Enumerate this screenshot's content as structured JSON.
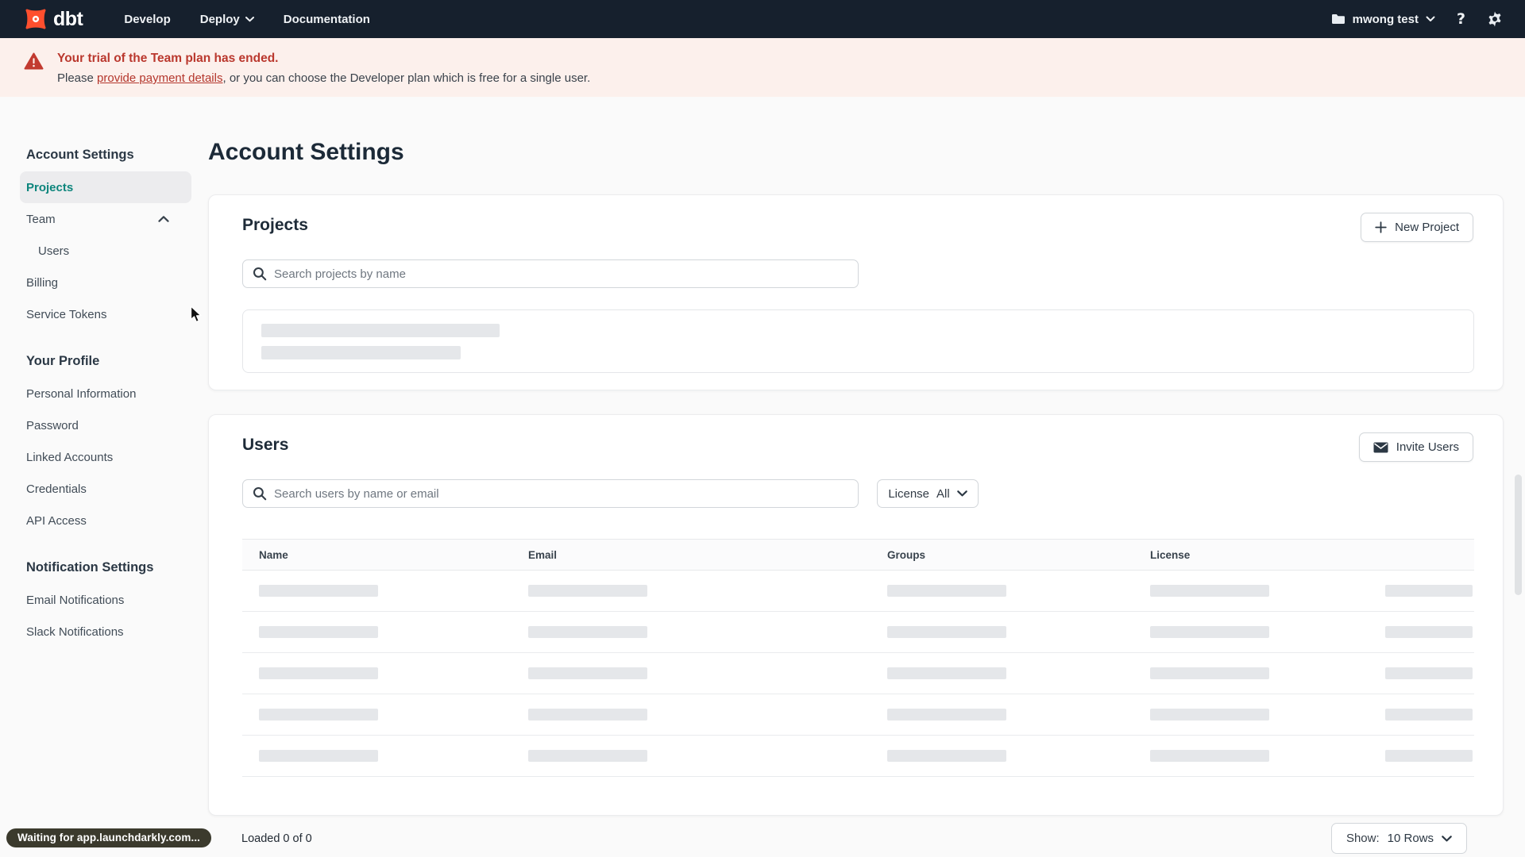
{
  "navbar": {
    "logo_text": "dbt",
    "menu": [
      {
        "label": "Develop"
      },
      {
        "label": "Deploy",
        "has_chevron": true
      },
      {
        "label": "Documentation"
      }
    ],
    "account_label": "mwong test",
    "help_glyph": "?"
  },
  "banner": {
    "title": "Your trial of the Team plan has ended.",
    "body_prefix": "Please ",
    "link_text": "provide payment details",
    "body_suffix": ", or you can choose the Developer plan which is free for a single user."
  },
  "sidebar": {
    "sections": [
      {
        "heading": "Account Settings",
        "items": [
          {
            "label": "Projects",
            "active": true
          },
          {
            "label": "Team",
            "expanded": true
          },
          {
            "label": "Users",
            "child": true
          },
          {
            "label": "Billing"
          },
          {
            "label": "Service Tokens"
          }
        ]
      },
      {
        "heading": "Your Profile",
        "items": [
          {
            "label": "Personal Information"
          },
          {
            "label": "Password"
          },
          {
            "label": "Linked Accounts"
          },
          {
            "label": "Credentials"
          },
          {
            "label": "API Access"
          }
        ]
      },
      {
        "heading": "Notification Settings",
        "items": [
          {
            "label": "Email Notifications"
          },
          {
            "label": "Slack Notifications"
          }
        ]
      }
    ]
  },
  "main": {
    "title": "Account Settings"
  },
  "projects_card": {
    "heading": "Projects",
    "new_button": "New Project",
    "search_placeholder": "Search projects by name"
  },
  "users_card": {
    "heading": "Users",
    "invite_button": "Invite Users",
    "search_placeholder": "Search users by name or email",
    "license_label": "License",
    "license_value": "All",
    "columns": [
      "Name",
      "Email",
      "Groups",
      "License"
    ],
    "skeleton_rows": 5
  },
  "pagination": {
    "loaded_text": "Loaded 0 of 0",
    "show_label": "Show:",
    "show_value": "10 Rows"
  },
  "status_bubble": {
    "text": "Waiting for app.launchdarkly.com..."
  },
  "colors": {
    "brand_orange": "#ff4f2e",
    "accent_teal": "#0d857c",
    "alert_red": "#ba382e",
    "navbar_bg": "#16202d",
    "banner_bg": "#fcf0ec"
  }
}
